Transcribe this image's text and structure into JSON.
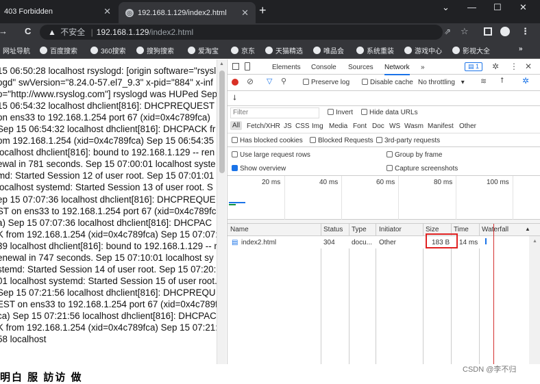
{
  "tabs": [
    {
      "title": "403 Forbidden",
      "close": "✕"
    },
    {
      "title": "192.168.1.129/index2.html",
      "close": "✕"
    }
  ],
  "new_tab": "+",
  "window_controls": {
    "chevron": "⌄",
    "minimize": "—",
    "maximize": "☐",
    "close": "✕"
  },
  "address": {
    "back": "←",
    "forward": "→",
    "reload": "C",
    "warning": "不安全",
    "url_host": "192.168.1.129",
    "url_path": "/index2.html"
  },
  "bookmarks": [
    "网址导航",
    "百度搜索",
    "360搜索",
    "搜狗搜索",
    "爱淘宝",
    "京东",
    "天猫精选",
    "唯品会",
    "系统重装",
    "游戏中心",
    "影视大全"
  ],
  "bookmarks_more": "»",
  "log_text": "15 06:50:28 localhost rsyslogd: [origin software=\"rsyslogd\" swVersion=\"8.24.0-57.el7_9.3\" x-pid=\"884\" x-info=\"http://www.rsyslog.com\"] rsyslogd was HUPed Sep 15 06:54:32 localhost dhclient[816]: DHCPREQUEST on ens33 to 192.168.1.254 port 67 (xid=0x4c789fca) Sep 15 06:54:32 localhost dhclient[816]: DHCPACK from 192.168.1.254 (xid=0x4c789fca) Sep 15 06:54:35 localhost dhclient[816]: bound to 192.168.1.129 -- renewal in 781 seconds. Sep 15 07:00:01 localhost systemd: Started Session 12 of user root. Sep 15 07:01:01 localhost systemd: Started Session 13 of user root. Sep 15 07:07:36 localhost dhclient[816]: DHCPREQUEST on ens33 to 192.168.1.254 port 67 (xid=0x4c789fca) Sep 15 07:07:36 localhost dhclient[816]: DHCPACK from 192.168.1.254 (xid=0x4c789fca) Sep 15 07:07:39 localhost dhclient[816]: bound to 192.168.1.129 -- renewal in 747 seconds. Sep 15 07:10:01 localhost systemd: Started Session 14 of user root. Sep 15 07:20:01 localhost systemd: Started Session 15 of user root. Sep 15 07:21:56 localhost dhclient[816]: DHCPREQUEST on ens33 to 192.168.1.254 port 67 (xid=0x4c789fca) Sep 15 07:21:56 localhost dhclient[816]: DHCPACK from 192.168.1.254 (xid=0x4c789fca) Sep 15 07:21:58 localhost",
  "devtools": {
    "tabs": [
      "Elements",
      "Console",
      "Sources",
      "Network"
    ],
    "more": "»",
    "badge": "1",
    "preserve_log": "Preserve log",
    "disable_cache": "Disable cache",
    "throttling": "No throttling",
    "filter_placeholder": "Filter",
    "invert": "Invert",
    "hide_data_urls": "Hide data URLs",
    "type_filters": [
      "All",
      "Fetch/XHR",
      "JS",
      "CSS",
      "Img",
      "Media",
      "Font",
      "Doc",
      "WS",
      "Wasm",
      "Manifest",
      "Other"
    ],
    "has_blocked_cookies": "Has blocked cookies",
    "blocked_requests": "Blocked Requests",
    "third_party": "3rd-party requests",
    "use_large_rows": "Use large request rows",
    "group_by_frame": "Group by frame",
    "show_overview": "Show overview",
    "capture_screenshots": "Capture screenshots",
    "timeline_ticks": [
      "20 ms",
      "40 ms",
      "60 ms",
      "80 ms",
      "100 ms"
    ],
    "columns": [
      "Name",
      "Status",
      "Type",
      "Initiator",
      "Size",
      "Time",
      "Waterfall"
    ],
    "rows": [
      {
        "name": "index2.html",
        "status": "304",
        "type": "docu...",
        "initiator": "Other",
        "size": "183 B",
        "time": "14 ms"
      }
    ]
  },
  "bottom_text": "明白 服 訪访 做",
  "watermark": "CSDN @李不归"
}
